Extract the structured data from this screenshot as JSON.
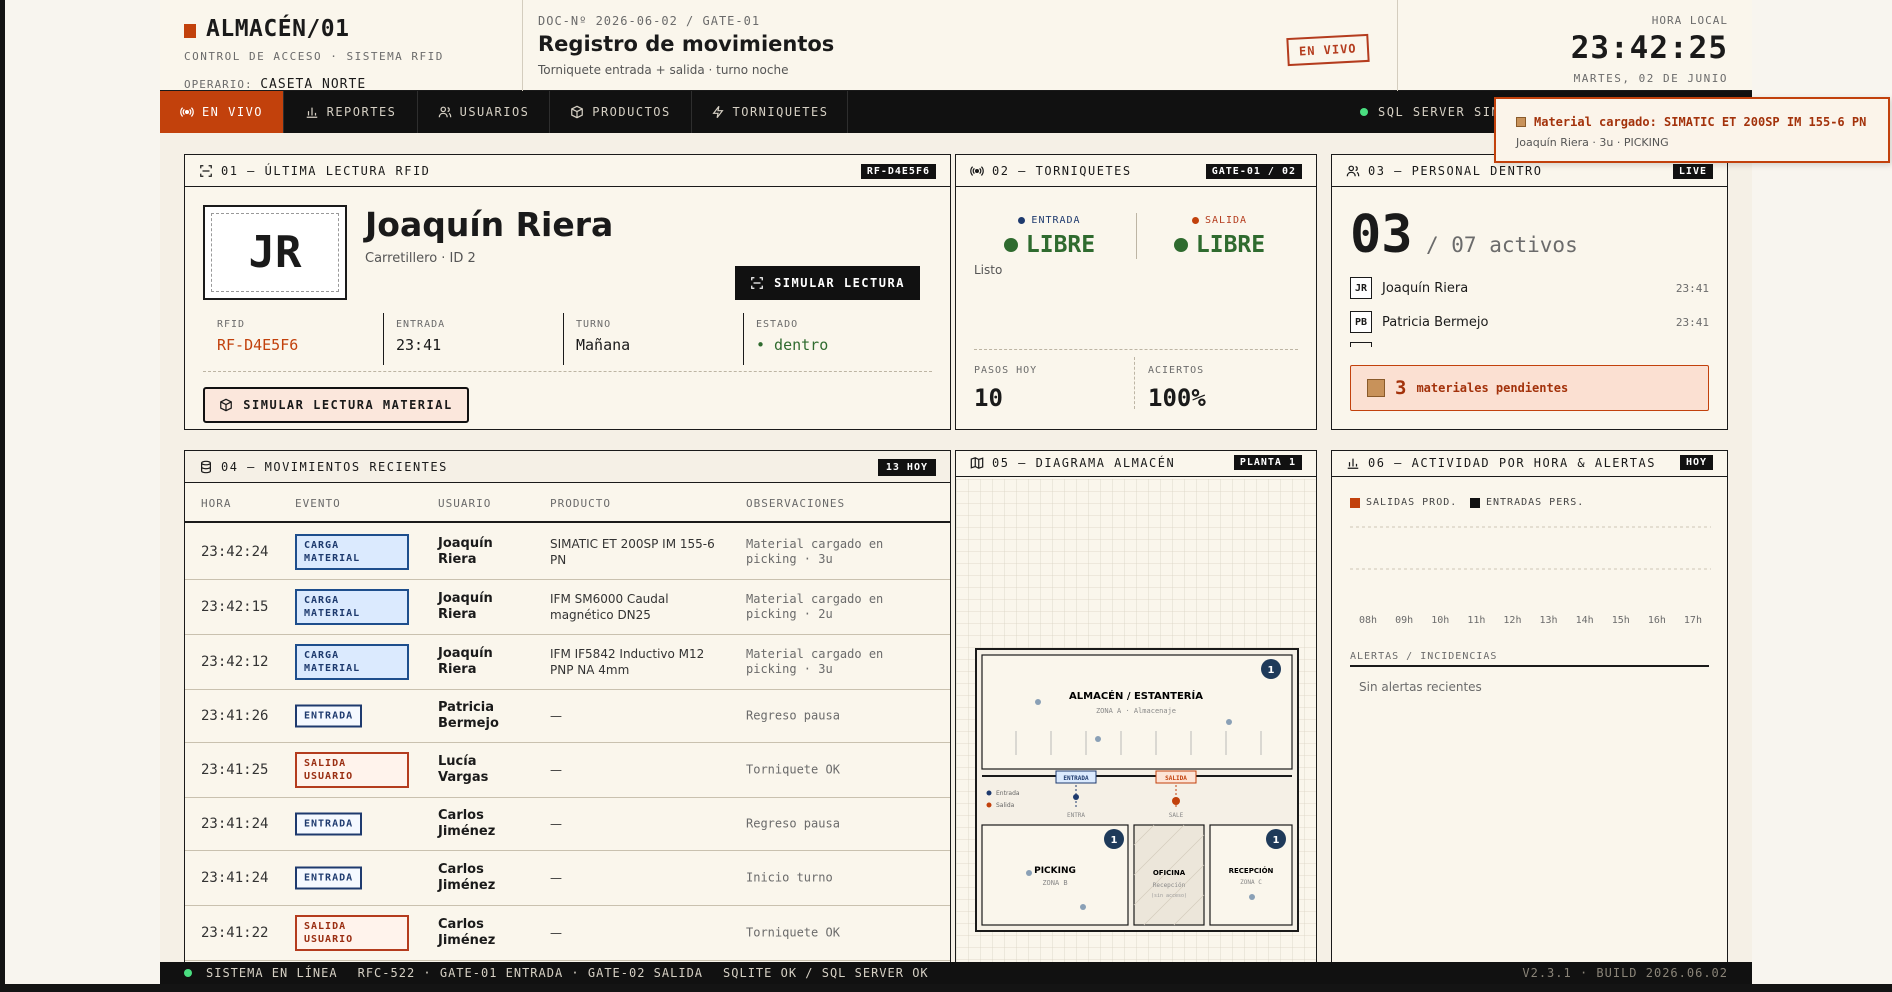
{
  "header": {
    "brand_title": "ALMACÉN/01",
    "brand_subtitle": "CONTROL DE ACCESO · SISTEMA RFID",
    "operator_label": "OPERARIO:",
    "operator_value": "CASETA NORTE",
    "doc_number": "DOC-Nº 2026-06-02 / GATE-01",
    "doc_title": "Registro de movimientos",
    "doc_subtitle": "Torniquete entrada + salida · turno noche",
    "live_stamp": "EN VIVO",
    "clock_label": "HORA LOCAL",
    "clock_time": "23:42:25",
    "clock_date": "MARTES, 02 DE JUNIO"
  },
  "nav": {
    "tabs": [
      {
        "label": "EN VIVO",
        "icon": "broadcast-icon"
      },
      {
        "label": "REPORTES",
        "icon": "bar-chart-icon"
      },
      {
        "label": "USUARIOS",
        "icon": "users-icon"
      },
      {
        "label": "PRODUCTOS",
        "icon": "box-icon"
      },
      {
        "label": "TORNIQUETES",
        "icon": "bolt-icon"
      }
    ],
    "sync_label": "SQL SERVER SINC"
  },
  "rfid": {
    "title": "01 — ÚLTIMA LECTURA RFID",
    "badge": "RF-D4E5F6",
    "initials": "JR",
    "name": "Joaquín Riera",
    "role": "Carretillero · ID 2",
    "simulate_button": "SIMULAR LECTURA",
    "fields": [
      {
        "key": "RFID",
        "value": "RF-D4E5F6"
      },
      {
        "key": "ENTRADA",
        "value": "23:41"
      },
      {
        "key": "TURNO",
        "value": "Mañana"
      },
      {
        "key": "ESTADO",
        "value": "• dentro"
      }
    ],
    "material_button": "SIMULAR LECTURA MATERIAL"
  },
  "turnstiles": {
    "title": "02 — TORNIQUETES",
    "badge": "GATE-01 / 02",
    "entry_label": "ENTRADA",
    "entry_status": "LIBRE",
    "exit_label": "SALIDA",
    "exit_status": "LIBRE",
    "ready_text": "Listo",
    "steps_label": "PASOS HOY",
    "steps_value": "10",
    "hits_label": "ACIERTOS",
    "hits_value": "100%"
  },
  "personnel": {
    "title": "03 — PERSONAL DENTRO",
    "badge": "LIVE",
    "count": "03",
    "count_sub": "/ 07 activos",
    "people": [
      {
        "initials": "JR",
        "name": "Joaquín Riera",
        "time": "23:41"
      },
      {
        "initials": "PB",
        "name": "Patricia Bermejo",
        "time": "23:41"
      }
    ],
    "pending_count": "3",
    "pending_label": "materiales pendientes"
  },
  "movements": {
    "title": "04 — MOVIMIENTOS RECIENTES",
    "badge": "13 HOY",
    "columns": [
      "HORA",
      "EVENTO",
      "USUARIO",
      "PRODUCTO",
      "OBSERVACIONES"
    ],
    "rows": [
      {
        "time": "23:42:24",
        "event": "CARGA MATERIAL",
        "type": "carga",
        "user": "Joaquín Riera",
        "product": "SIMATIC ET 200SP IM 155-6 PN",
        "obs": "Material cargado en picking · 3u"
      },
      {
        "time": "23:42:15",
        "event": "CARGA MATERIAL",
        "type": "carga",
        "user": "Joaquín Riera",
        "product": "IFM SM6000 Caudal magnético DN25",
        "obs": "Material cargado en picking · 2u"
      },
      {
        "time": "23:42:12",
        "event": "CARGA MATERIAL",
        "type": "carga",
        "user": "Joaquín Riera",
        "product": "IFM IF5842 Inductivo M12 PNP NA 4mm",
        "obs": "Material cargado en picking · 3u"
      },
      {
        "time": "23:41:26",
        "event": "ENTRADA",
        "type": "entrada",
        "user": "Patricia Bermejo",
        "product": "—",
        "obs": "Regreso pausa"
      },
      {
        "time": "23:41:25",
        "event": "SALIDA USUARIO",
        "type": "salida",
        "user": "Lucía Vargas",
        "product": "—",
        "obs": "Torniquete OK"
      },
      {
        "time": "23:41:24",
        "event": "ENTRADA",
        "type": "entrada",
        "user": "Carlos Jiménez",
        "product": "—",
        "obs": "Regreso pausa"
      },
      {
        "time": "23:41:24",
        "event": "ENTRADA",
        "type": "entrada",
        "user": "Carlos Jiménez",
        "product": "—",
        "obs": "Inicio turno"
      },
      {
        "time": "23:41:22",
        "event": "SALIDA USUARIO",
        "type": "salida",
        "user": "Carlos Jiménez",
        "product": "—",
        "obs": "Torniquete OK"
      }
    ]
  },
  "diagram": {
    "title": "05 — DIAGRAMA ALMACÉN",
    "badge": "PLANTA 1",
    "warehouse": "ALMACÉN / ESTANTERÍA",
    "warehouse_zone": "ZONA A · Almacenaje",
    "warehouse_count": "1",
    "picking": "PICKING",
    "picking_zone": "ZONA B",
    "picking_count": "1",
    "office": "OFICINA",
    "office_sub": "Recepción",
    "office_note": "(sin acceso)",
    "reception": "RECEPCIÓN",
    "reception_zone": "ZONA C",
    "reception_count": "1",
    "entry_tag": "ENTRADA",
    "exit_tag": "SALIDA",
    "entry_flow": "ENTRA",
    "exit_flow": "SALE",
    "legend_entry": "Entrada",
    "legend_exit": "Salida"
  },
  "activity": {
    "title": "06 — ACTIVIDAD POR HORA & ALERTAS",
    "badge": "HOY",
    "alerts_title": "ALERTAS / INCIDENCIAS",
    "alerts_empty": "Sin alertas recientes"
  },
  "chart_data": {
    "type": "bar",
    "categories": [
      "08h",
      "09h",
      "10h",
      "11h",
      "12h",
      "13h",
      "14h",
      "15h",
      "16h",
      "17h"
    ],
    "series": [
      {
        "name": "SALIDAS PROD.",
        "values": [
          0,
          0,
          0,
          0,
          0,
          0,
          0,
          0,
          0,
          0
        ],
        "color": "#c2410c"
      },
      {
        "name": "ENTRADAS PERS.",
        "values": [
          0,
          0,
          0,
          0,
          0,
          0,
          0,
          0,
          0,
          0
        ],
        "color": "#111111"
      }
    ],
    "grid": true,
    "legend": "top-left"
  },
  "footer": {
    "status": "SISTEMA EN LÍNEA",
    "gates": "RFC-522 · GATE-01 ENTRADA · GATE-02 SALIDA",
    "db": "SQLITE OK / SQL SERVER OK",
    "version": "V2.3.1 · BUILD 2026.06.02"
  },
  "toast": {
    "title": "Material cargado: SIMATIC ET 200SP IM 155-6 PN",
    "detail": "Joaquín Riera · 3u · PICKING"
  },
  "colors": {
    "accent": "#c2410c",
    "dark": "#111111",
    "paper": "#faf6ec",
    "ok_green": "#2f6b2f",
    "info_blue": "#1e3a6e"
  }
}
